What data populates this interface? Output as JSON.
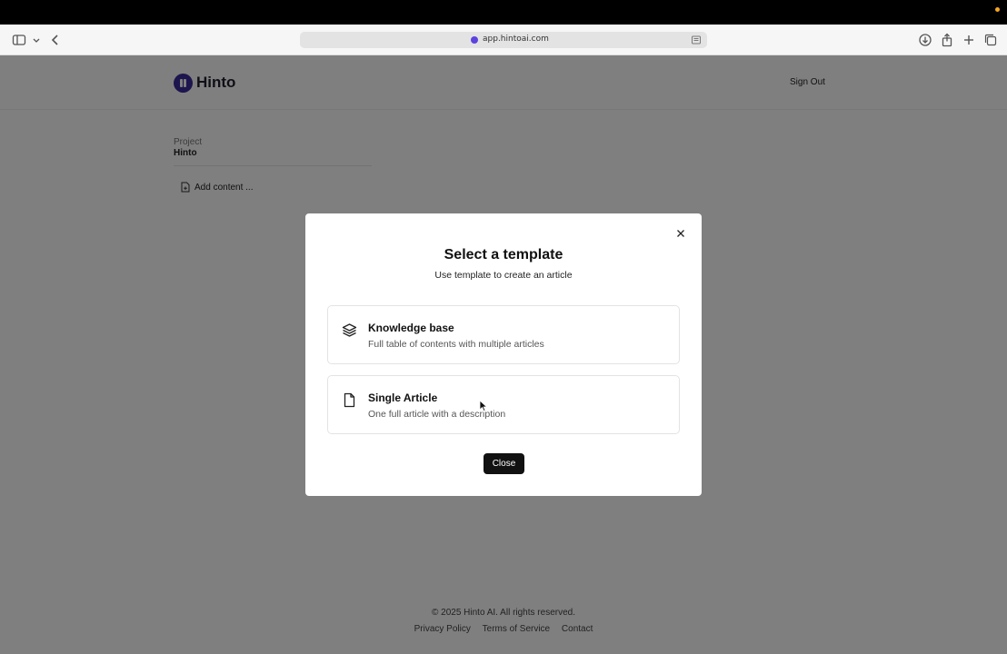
{
  "browser": {
    "url": "app.hintoai.com"
  },
  "header": {
    "logo_text": "Hinto",
    "sign_out": "Sign Out"
  },
  "sidebar": {
    "project_label": "Project",
    "project_name": "Hinto",
    "add_content": "Add content ..."
  },
  "footer": {
    "copyright": "© 2025 Hinto AI. All rights reserved.",
    "links": [
      "Privacy Policy",
      "Terms of Service",
      "Contact"
    ]
  },
  "modal": {
    "title": "Select a template",
    "subtitle": "Use template to create an article",
    "options": [
      {
        "title": "Knowledge base",
        "description": "Full table of contents with multiple articles",
        "icon": "layers-icon"
      },
      {
        "title": "Single Article",
        "description": "One full article with a description",
        "icon": "file-icon"
      }
    ],
    "close_button": "Close"
  },
  "colors": {
    "brand": "#3b2a9a",
    "overlay": "rgba(0,0,0,0.5)",
    "button_bg": "#111111"
  }
}
